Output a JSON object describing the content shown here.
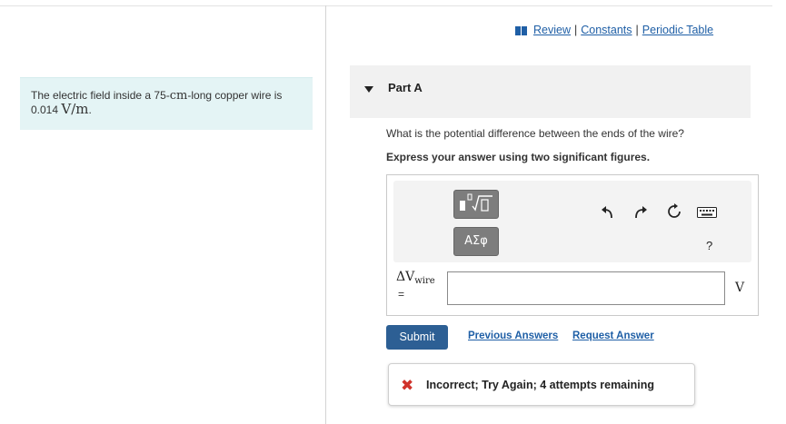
{
  "problem": {
    "text_before": "The electric field inside a 75-",
    "unit_cm": "cm",
    "text_middle": "-long copper wire is 0.014 ",
    "field_unit": "V/m",
    "text_after": "."
  },
  "top_links": {
    "review": "Review",
    "constants": "Constants",
    "periodic_table": "Periodic Table",
    "separator": "|"
  },
  "part": {
    "title": "Part A"
  },
  "question": "What is the potential difference between the ends of the wire?",
  "instruction": "Express your answer using two significant figures.",
  "toolbar": {
    "greek_label": "ΑΣφ",
    "help_label": "?",
    "icons": [
      "template-icon",
      "undo-icon",
      "redo-icon",
      "reset-icon",
      "keyboard-icon"
    ]
  },
  "answer": {
    "variable_main": "ΔV",
    "variable_sub": "wire",
    "equals": "=",
    "value": "",
    "unit": "V"
  },
  "buttons": {
    "submit": "Submit",
    "previous_answers": "Previous Answers",
    "request_answer": "Request Answer"
  },
  "feedback": {
    "icon": "x-icon",
    "message": "Incorrect; Try Again; 4 attempts remaining",
    "color": "#d0332b"
  },
  "colors": {
    "link": "#1f5fa6",
    "submit_bg": "#2d5f94",
    "problem_bg": "#e4f4f5",
    "part_header_bg": "#f1f1f1"
  }
}
